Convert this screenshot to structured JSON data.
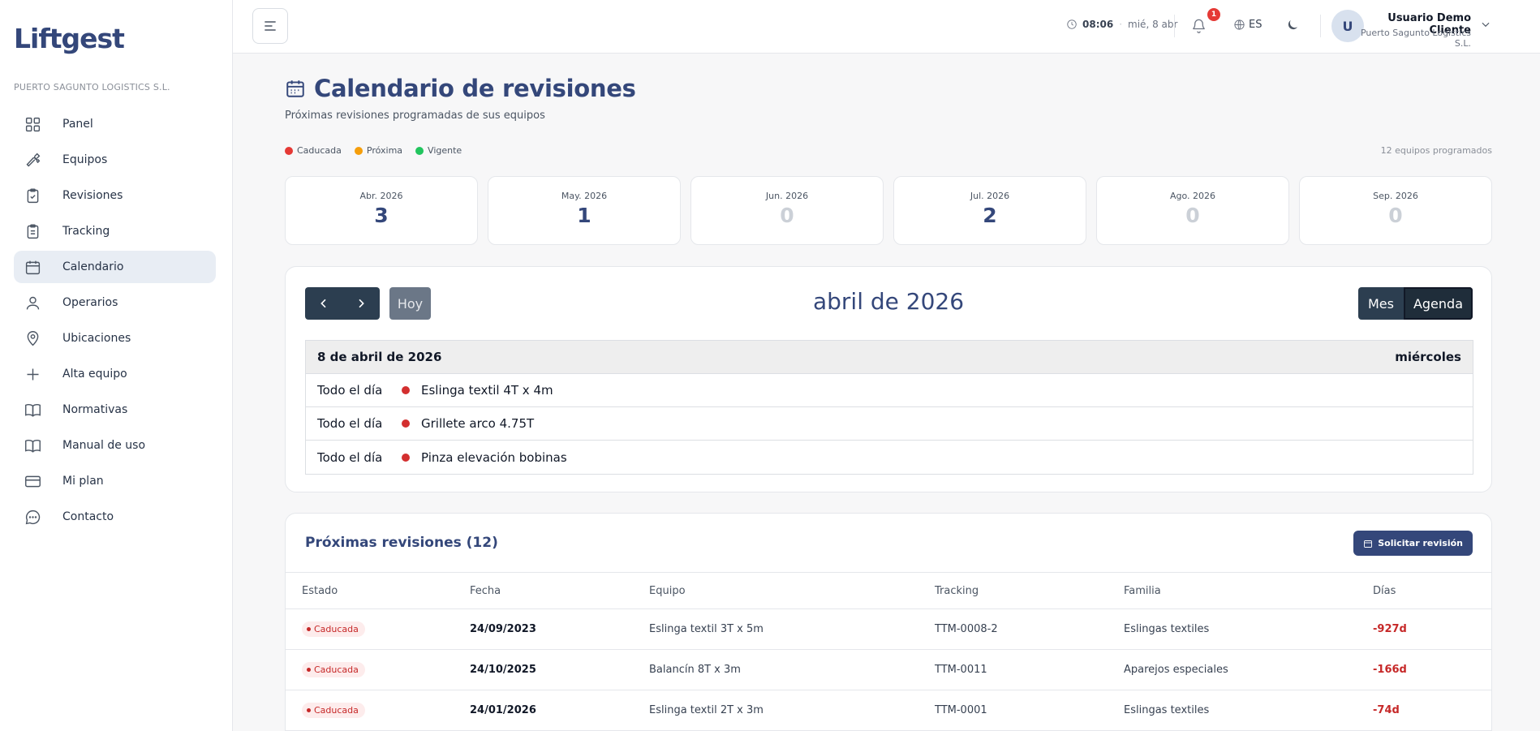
{
  "app": {
    "logo": "Liftgest",
    "company": "PUERTO SAGUNTO LOGISTICS S.L."
  },
  "sidebar": {
    "items": [
      {
        "label": "Panel",
        "icon": "grid-icon",
        "active": false
      },
      {
        "label": "Equipos",
        "icon": "wrench-icon",
        "active": false
      },
      {
        "label": "Revisiones",
        "icon": "clipboard-check-icon",
        "active": false
      },
      {
        "label": "Tracking",
        "icon": "clipboard-list-icon",
        "active": false
      },
      {
        "label": "Calendario",
        "icon": "calendar-icon",
        "active": true
      },
      {
        "label": "Operarios",
        "icon": "user-icon",
        "active": false
      },
      {
        "label": "Ubicaciones",
        "icon": "map-pin-icon",
        "active": false
      },
      {
        "label": "Alta equipo",
        "icon": "plus-icon",
        "active": false
      },
      {
        "label": "Normativas",
        "icon": "book-icon",
        "active": false
      },
      {
        "label": "Manual de uso",
        "icon": "book-open-icon",
        "active": false
      },
      {
        "label": "Mi plan",
        "icon": "credit-card-icon",
        "active": false
      },
      {
        "label": "Contacto",
        "icon": "chat-icon",
        "active": false
      }
    ]
  },
  "header": {
    "time": "08:06",
    "date": "mié, 8 abr",
    "notifications": "1",
    "language": "ES",
    "avatar_initial": "U",
    "user_name": "Usuario Demo Cliente",
    "user_company": "Puerto Sagunto Logistics S.L."
  },
  "page": {
    "title": "Calendario de revisiones",
    "subtitle": "Próximas revisiones programadas de sus equipos",
    "legend": [
      {
        "label": "Caducada",
        "color": "#e53935"
      },
      {
        "label": "Próxima",
        "color": "#f59e0b"
      },
      {
        "label": "Vigente",
        "color": "#22c55e"
      }
    ],
    "equipment_count": "12 equipos programados"
  },
  "months": [
    {
      "label": "Abr. 2026",
      "value": "3"
    },
    {
      "label": "May. 2026",
      "value": "1"
    },
    {
      "label": "Jun. 2026",
      "value": "0"
    },
    {
      "label": "Jul. 2026",
      "value": "2"
    },
    {
      "label": "Ago. 2026",
      "value": "0"
    },
    {
      "label": "Sep. 2026",
      "value": "0"
    }
  ],
  "calendar": {
    "today_label": "Hoy",
    "title": "abril de 2026",
    "view_month": "Mes",
    "view_agenda": "Agenda",
    "agenda_date": "8 de abril de 2026",
    "agenda_weekday": "miércoles",
    "events": [
      {
        "time": "Todo el día",
        "title": "Eslinga textil 4T x 4m"
      },
      {
        "time": "Todo el día",
        "title": "Grillete arco 4.75T"
      },
      {
        "time": "Todo el día",
        "title": "Pinza elevación bobinas"
      }
    ]
  },
  "upcoming": {
    "title": "Próximas revisiones (12)",
    "request_button": "Solicitar revisión",
    "columns": [
      "Estado",
      "Fecha",
      "Equipo",
      "Tracking",
      "Familia",
      "Días"
    ],
    "rows": [
      {
        "status": "Caducada",
        "date": "24/09/2023",
        "equipment": "Eslinga textil 3T x 5m",
        "tracking": "TTM-0008-2",
        "family": "Eslingas textiles",
        "days": "-927d"
      },
      {
        "status": "Caducada",
        "date": "24/10/2025",
        "equipment": "Balancín 8T x 3m",
        "tracking": "TTM-0011",
        "family": "Aparejos especiales",
        "days": "-166d"
      },
      {
        "status": "Caducada",
        "date": "24/01/2026",
        "equipment": "Eslinga textil 2T x 3m",
        "tracking": "TTM-0001",
        "family": "Eslingas textiles",
        "days": "-74d"
      }
    ]
  }
}
